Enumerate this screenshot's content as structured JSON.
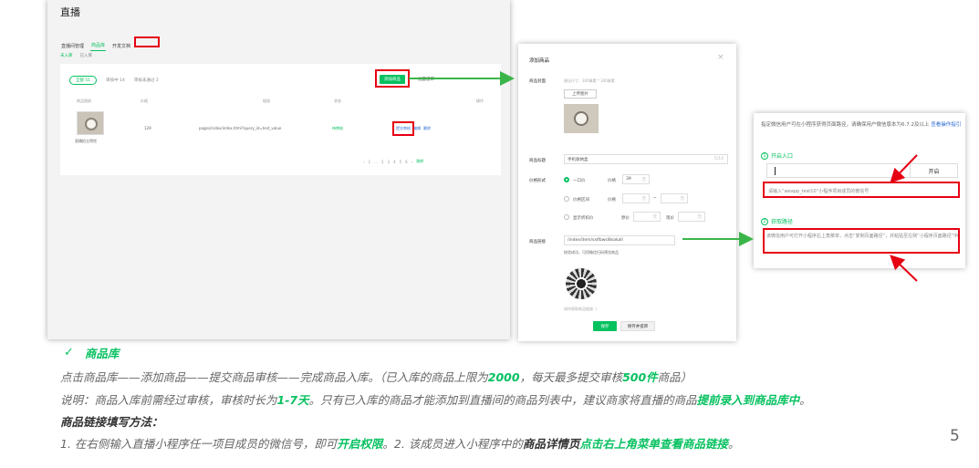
{
  "console": {
    "title": "直播",
    "tabs": [
      "直播间管理",
      "商品库",
      "开发文档"
    ],
    "subtabs": [
      "未入库",
      "已入库"
    ],
    "filters": [
      "全部 51",
      "审核中 14",
      "审核未通过 3"
    ],
    "add_button": "添加商品",
    "batch_label": "批量提审",
    "columns": [
      "商品图册",
      "价格",
      "链接",
      "状态",
      "操作"
    ],
    "row": {
      "name": "直播拍立得兜",
      "price": "129",
      "link": "pages/index/index.html?query_id=test_value",
      "status": "待审核",
      "actions": [
        "提交审核",
        "编辑",
        "删除"
      ]
    },
    "pager": [
      "‹",
      "1",
      "...",
      "2",
      "3",
      "4",
      "5",
      "6",
      "›",
      "跳转"
    ]
  },
  "modal": {
    "title": "添加商品",
    "close": "×",
    "cover_label": "商品封面",
    "cover_hint": "建议尺寸：300像素 * 300像素",
    "upload_button": "上传图片",
    "name_label": "商品标题",
    "name_value": "手机收纳盒",
    "name_count": "5/14",
    "price_label": "价格形式",
    "price_options": [
      "一口价",
      "价格区间",
      "显示折扣价"
    ],
    "price_field": "价格",
    "price_value": "39",
    "price_unit": "元",
    "range_sep": "~",
    "origin_price": "原价",
    "current_price": "现价",
    "link_label": "商品链接",
    "link_value": "/index/item/sxlfbwsl8sakall",
    "link_hint": "校验成功，可用微信扫码预览商品",
    "help_link": "如何获取商品链接 ⓘ",
    "save_button": "保存",
    "submit_button": "保存并提审"
  },
  "help": {
    "intro": "指定微信用户可在小程序获得页面路径，请确保用户微信版本为6.7.2及以上",
    "guide_link": "查看操作指引",
    "step1": "开启入口",
    "step1_num": "1",
    "open_button": "开启",
    "placeholder": "请输入“weapp_test10”小程序项目成员的微信号",
    "step2": "获取路径",
    "step2_num": "2",
    "step2_desc": "该微信用户可打开小程序右上角菜单，点击“复制页面路径”，并粘贴至左侧“小程序页面路径”中"
  },
  "bottom": {
    "check": "✓",
    "section_title": "商品库",
    "line1": {
      "a": "点击商品库——添加商品——提交商品审核——完成商品入库。（已入库的商品上限为",
      "b": "2000",
      "c": "，每天最多提交审核",
      "d": "500件",
      "e": "商品）"
    },
    "line2": {
      "a": "说明：商品入库前需经过审核，审核时长为",
      "b": "1-7天",
      "c": "。只有已入库的商品才能添加到直播间的商品列表中，建议商家将直播的商品",
      "d": "提前录入到商品库中",
      "e": "。"
    },
    "heading2": "商品链接填写方法：",
    "line3": {
      "a": "1. 在右侧输入直播小程序任一项目成员的微信号，即可",
      "b": "开启权限",
      "c": "。2. 该成员进入小程序中的",
      "d": "商品详情页",
      "e": "点击右上角菜单查看商品链接",
      "f": "。"
    },
    "page_number": "5"
  },
  "colors": {
    "accent": "#07c160",
    "highlight": "#e60012",
    "link": "#2d6bd4"
  }
}
